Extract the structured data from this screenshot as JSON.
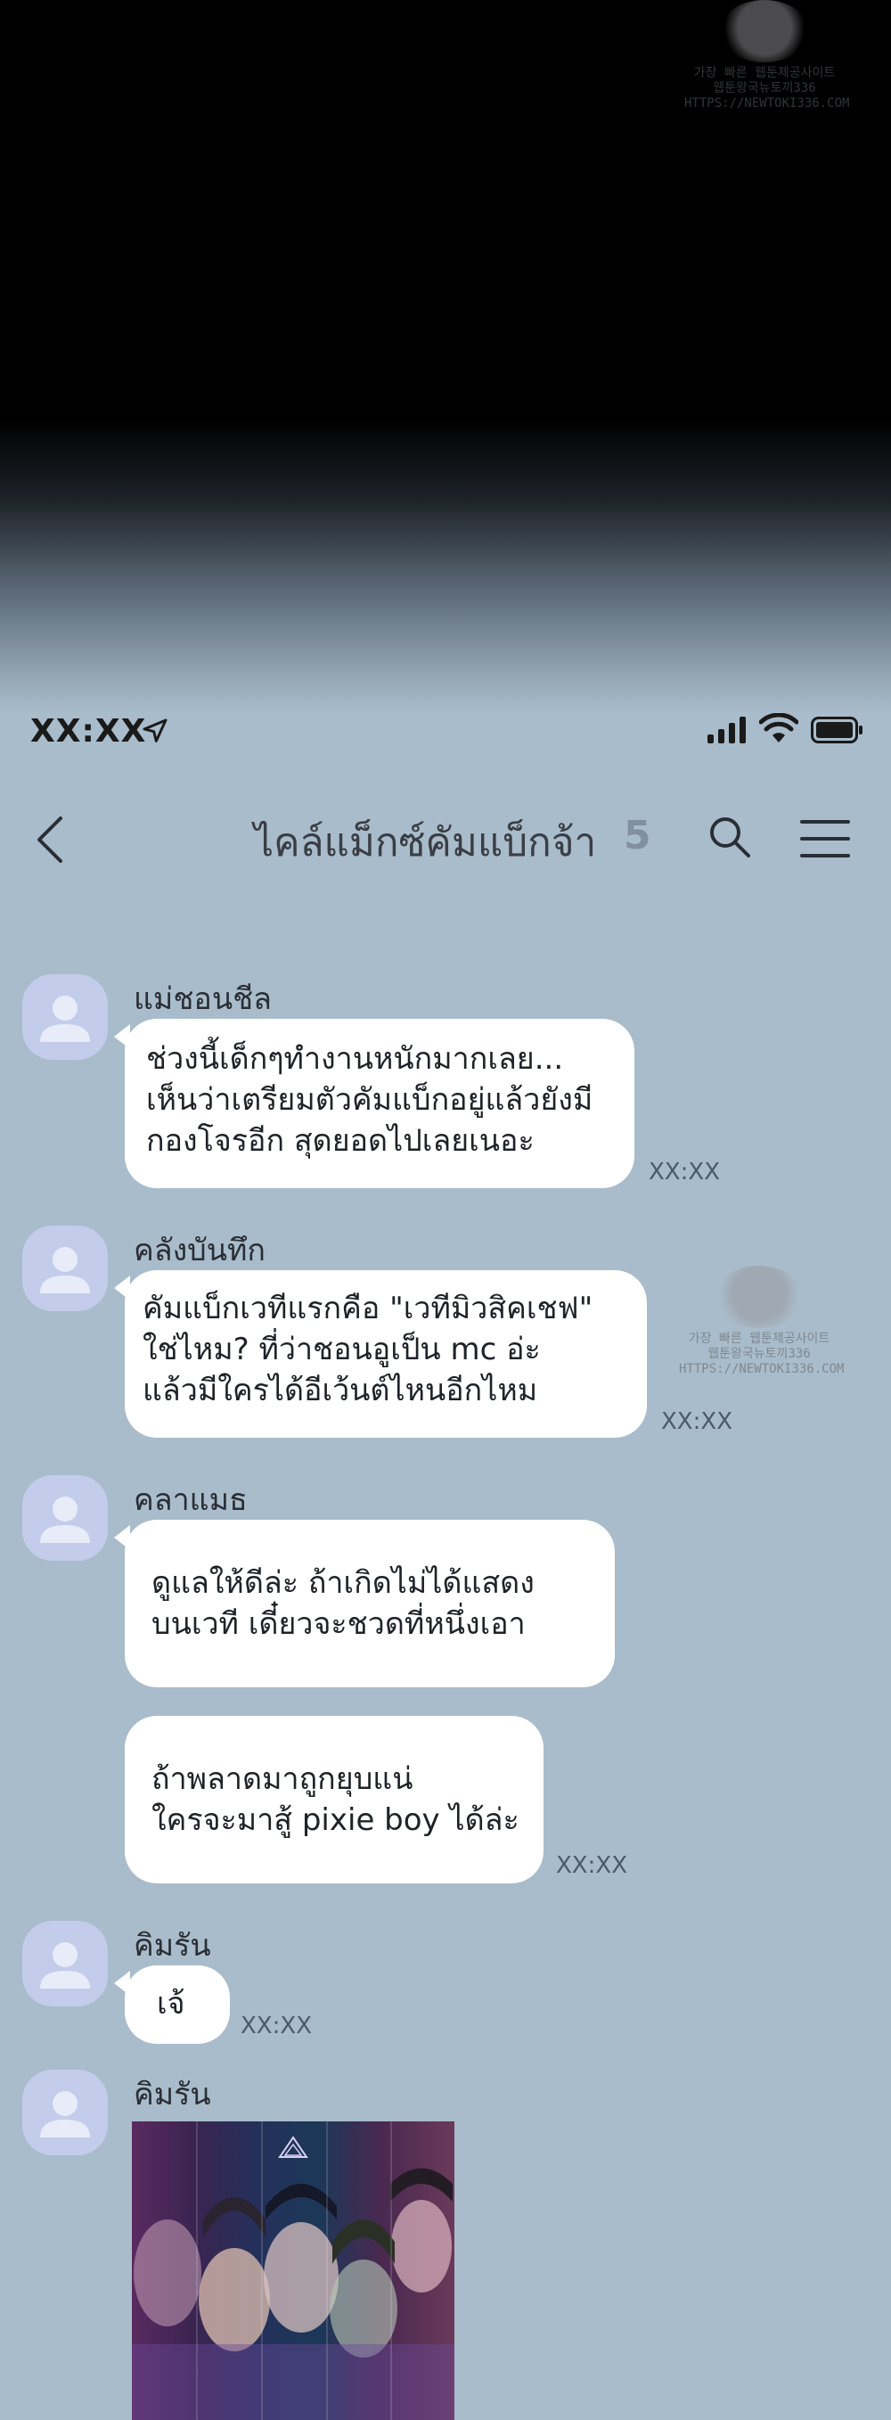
{
  "watermark": {
    "line1": "가장 빠른 웹툰제공사이트",
    "line2": "웹툰왕국뉴토끼336",
    "line3": "HTTPS://NEWTOKI336.COM"
  },
  "status": {
    "time": "XX:XX",
    "icons": [
      "location-arrow-icon",
      "signal-bars-icon",
      "wifi-icon",
      "battery-icon"
    ]
  },
  "header": {
    "title": "ไคล์แม็กซ์คัมแบ็กจ้า",
    "member_count": "5",
    "icons": [
      "back-chevron-icon",
      "search-icon",
      "hamburger-menu-icon"
    ]
  },
  "messages": [
    {
      "sender": "แม่ชอนชีล",
      "lines": [
        "ช่วงนี้เด็กๆทำงานหนักมากเลย...",
        "เห็นว่าเตรียมตัวคัมแบ็กอยู่แล้วยังมี",
        "กองโจรอีก สุดยอดไปเลยเนอะ"
      ],
      "time": "XX:XX"
    },
    {
      "sender": "คลังบันทึก",
      "lines": [
        "คัมแบ็กเวทีแรกคือ \"เวทีมิวสิคเชฟ\"",
        "ใช่ไหม? ที่ว่าชอนอูเป็น mc อ่ะ",
        "แล้วมีใครได้อีเว้นต์ไหนอีกไหม"
      ],
      "time": "XX:XX"
    },
    {
      "sender": "คลาแมธ",
      "lines": [
        "ดูแลให้ดีล่ะ ถ้าเกิดไม่ได้แสดง",
        "บนเวที เดี๋ยวจะชวดที่หนึ่งเอา"
      ]
    },
    {
      "lines": [
        "ถ้าพลาดมาถูกยุบแน่",
        "ใครจะมาสู้ pixie boy ได้ล่ะ"
      ],
      "time": "XX:XX"
    },
    {
      "sender": "คิมรัน",
      "lines": [
        "เจ้"
      ],
      "time": "XX:XX"
    },
    {
      "sender": "คิมรัน",
      "image": "group-artwork-image"
    }
  ],
  "colors": {
    "background": "#a9bccb",
    "bubble": "#ffffff",
    "avatar": "#c3cdeb",
    "count": "#8090a0"
  }
}
